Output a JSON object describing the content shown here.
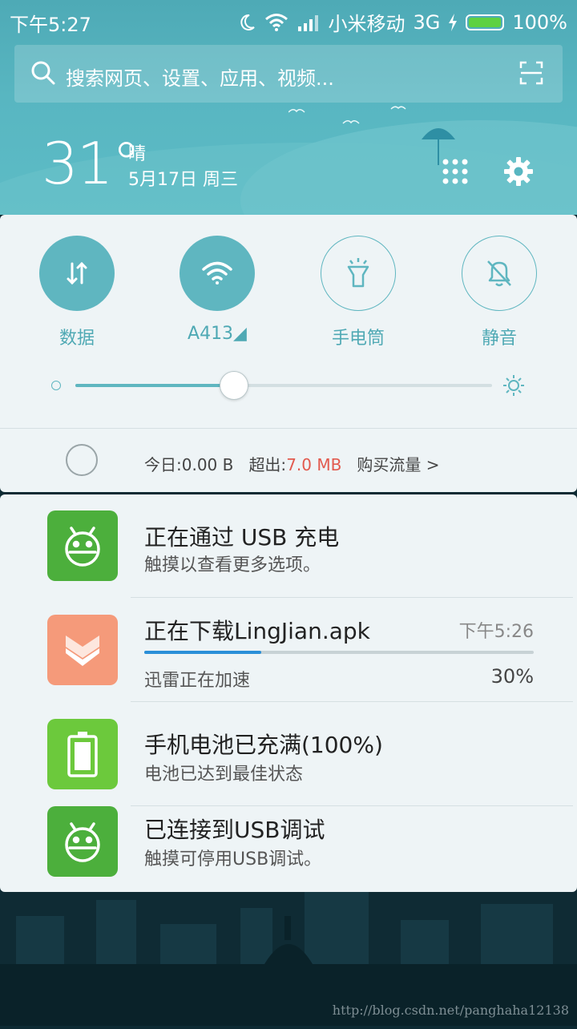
{
  "status_bar": {
    "time": "下午5:27",
    "carrier": "小米移动",
    "network": "3G",
    "battery_pct": "100%",
    "battery_level": 1.0
  },
  "search": {
    "placeholder": "搜索网页、设置、应用、视频..."
  },
  "weather": {
    "temp": "31°",
    "condition": "晴",
    "date": "5月17日 周三"
  },
  "toggles": [
    {
      "label": "数据",
      "on": true,
      "icon": "data-arrows-icon"
    },
    {
      "label": "A413◢",
      "on": true,
      "icon": "wifi-icon"
    },
    {
      "label": "手电筒",
      "on": false,
      "icon": "flashlight-icon"
    },
    {
      "label": "静音",
      "on": false,
      "icon": "bell-off-icon"
    }
  ],
  "brightness": {
    "level": 0.38
  },
  "data_usage": {
    "today": "今日:0.00 B",
    "over_label": "超出:",
    "over_value": "7.0 MB",
    "buy": "购买流量 >"
  },
  "notifications": [
    {
      "title": "正在通过 USB 充电",
      "sub": "触摸以查看更多选项。",
      "icon": "android-icon",
      "color": "#4caf3c"
    },
    {
      "title": "正在下载LingJian.apk",
      "time": "下午5:26",
      "sub": "迅雷正在加速",
      "progress_text": "30%",
      "progress": 0.3,
      "icon": "download-chevron-icon",
      "color": "#f59a7a"
    },
    {
      "title": "手机电池已充满(100%)",
      "sub": "电池已达到最佳状态",
      "icon": "battery-icon",
      "color": "#6cc93c"
    },
    {
      "title": "已连接到USB调试",
      "sub": "触摸可停用USB调试。",
      "icon": "android-icon",
      "color": "#4caf3c"
    }
  ],
  "watermark": "http://blog.csdn.net/panghaha12138"
}
